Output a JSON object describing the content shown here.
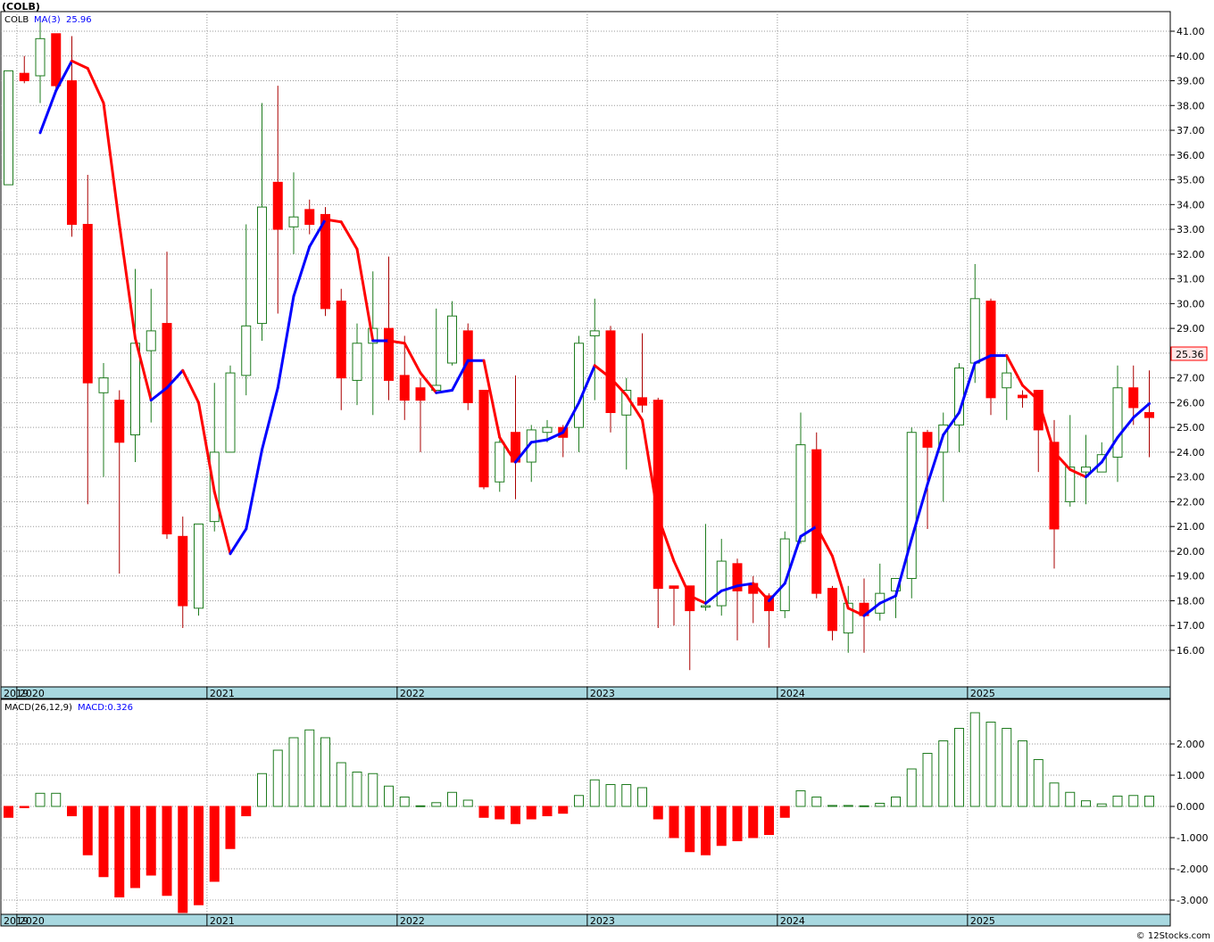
{
  "header": {
    "symbol_label": "(COLB)",
    "ma_symbol": "COLB",
    "ma_label": "MA(3)",
    "ma_value": "25.96",
    "macd_label": "MACD(26,12,9)",
    "macd_value_label": "MACD:0.326",
    "last_price": "25.36",
    "watermark": "© 12Stocks.com"
  },
  "colors": {
    "up_candle": "#1e7b1e",
    "down_candle": "#ff0000",
    "ma_up": "#0000ff",
    "ma_down": "#ff0000",
    "axis_band": "#a8d8e0",
    "price_box_fill": "#ffe6e6",
    "price_box_border": "#ff0000"
  },
  "chart_data": [
    {
      "type": "candlestick",
      "interval": "monthly",
      "ylim": [
        15.0,
        42.0
      ],
      "yticks": [
        "16.00",
        "17.00",
        "18.00",
        "19.00",
        "20.00",
        "21.00",
        "22.00",
        "23.00",
        "24.00",
        "25.00",
        "26.00",
        "27.00",
        "28.00",
        "29.00",
        "30.00",
        "31.00",
        "32.00",
        "33.00",
        "34.00",
        "35.00",
        "36.00",
        "37.00",
        "38.00",
        "39.00",
        "40.00",
        "41.00"
      ],
      "x_year_labels": [
        "2019",
        "2020",
        "2021",
        "2022",
        "2023",
        "2024",
        "2025"
      ],
      "x_year_positions": [
        -1,
        1,
        13,
        25,
        37,
        49,
        61
      ],
      "candles": [
        {
          "o": 34.8,
          "h": 38.8,
          "l": 35.1,
          "c": 39.4
        },
        {
          "o": 39.3,
          "h": 40.0,
          "l": 38.9,
          "c": 39.0
        },
        {
          "o": 39.2,
          "h": 41.5,
          "l": 38.1,
          "c": 40.7
        },
        {
          "o": 40.9,
          "h": 40.9,
          "l": 38.5,
          "c": 38.8
        },
        {
          "o": 39.0,
          "h": 40.8,
          "l": 32.7,
          "c": 33.2
        },
        {
          "o": 33.2,
          "h": 35.2,
          "l": 21.9,
          "c": 26.8
        },
        {
          "o": 26.4,
          "h": 27.6,
          "l": 23.0,
          "c": 27.0
        },
        {
          "o": 26.1,
          "h": 26.5,
          "l": 19.1,
          "c": 24.4
        },
        {
          "o": 24.7,
          "h": 31.4,
          "l": 23.6,
          "c": 28.4
        },
        {
          "o": 28.1,
          "h": 30.6,
          "l": 25.2,
          "c": 28.9
        },
        {
          "o": 29.2,
          "h": 32.1,
          "l": 20.5,
          "c": 20.7
        },
        {
          "o": 20.6,
          "h": 21.4,
          "l": 16.9,
          "c": 17.8
        },
        {
          "o": 17.7,
          "h": 21.0,
          "l": 17.4,
          "c": 21.1
        },
        {
          "o": 21.2,
          "h": 26.8,
          "l": 20.8,
          "c": 24.0
        },
        {
          "o": 24.0,
          "h": 27.5,
          "l": 24.1,
          "c": 27.2
        },
        {
          "o": 27.1,
          "h": 33.2,
          "l": 26.3,
          "c": 29.1
        },
        {
          "o": 29.2,
          "h": 38.1,
          "l": 28.5,
          "c": 33.9
        },
        {
          "o": 34.9,
          "h": 38.8,
          "l": 29.6,
          "c": 33.0
        },
        {
          "o": 33.1,
          "h": 35.3,
          "l": 32.0,
          "c": 33.5
        },
        {
          "o": 33.8,
          "h": 34.2,
          "l": 32.8,
          "c": 33.2
        },
        {
          "o": 33.6,
          "h": 33.9,
          "l": 29.5,
          "c": 29.8
        },
        {
          "o": 30.1,
          "h": 30.6,
          "l": 25.7,
          "c": 27.0
        },
        {
          "o": 26.9,
          "h": 29.2,
          "l": 25.9,
          "c": 28.4
        },
        {
          "o": 28.4,
          "h": 31.3,
          "l": 25.5,
          "c": 29.0
        },
        {
          "o": 29.0,
          "h": 31.9,
          "l": 26.1,
          "c": 26.9
        },
        {
          "o": 27.1,
          "h": 28.7,
          "l": 25.3,
          "c": 26.1
        },
        {
          "o": 26.6,
          "h": 27.0,
          "l": 24.0,
          "c": 26.1
        },
        {
          "o": 26.5,
          "h": 29.8,
          "l": 26.5,
          "c": 26.7
        },
        {
          "o": 27.6,
          "h": 30.1,
          "l": 27.5,
          "c": 29.5
        },
        {
          "o": 28.9,
          "h": 29.2,
          "l": 25.7,
          "c": 26.0
        },
        {
          "o": 26.5,
          "h": 26.4,
          "l": 22.5,
          "c": 22.6
        },
        {
          "o": 22.8,
          "h": 24.5,
          "l": 22.4,
          "c": 24.4
        },
        {
          "o": 24.8,
          "h": 27.1,
          "l": 22.1,
          "c": 23.6
        },
        {
          "o": 23.6,
          "h": 25.1,
          "l": 22.8,
          "c": 24.9
        },
        {
          "o": 24.8,
          "h": 25.3,
          "l": 24.4,
          "c": 25.0
        },
        {
          "o": 25.0,
          "h": 25.1,
          "l": 23.8,
          "c": 24.6
        },
        {
          "o": 25.0,
          "h": 28.7,
          "l": 24.0,
          "c": 28.4
        },
        {
          "o": 28.7,
          "h": 30.2,
          "l": 26.1,
          "c": 28.9
        },
        {
          "o": 28.9,
          "h": 29.1,
          "l": 24.8,
          "c": 25.6
        },
        {
          "o": 25.5,
          "h": 27.0,
          "l": 23.3,
          "c": 26.5
        },
        {
          "o": 26.2,
          "h": 28.8,
          "l": 25.6,
          "c": 25.9
        },
        {
          "o": 26.1,
          "h": 26.2,
          "l": 16.9,
          "c": 18.5
        },
        {
          "o": 18.6,
          "h": 18.6,
          "l": 17.0,
          "c": 18.5
        },
        {
          "o": 18.6,
          "h": 18.6,
          "l": 15.2,
          "c": 17.6
        },
        {
          "o": 17.8,
          "h": 21.1,
          "l": 17.6,
          "c": 17.8
        },
        {
          "o": 17.8,
          "h": 20.5,
          "l": 17.4,
          "c": 19.6
        },
        {
          "o": 19.5,
          "h": 19.7,
          "l": 16.4,
          "c": 18.4
        },
        {
          "o": 18.7,
          "h": 19.0,
          "l": 17.1,
          "c": 18.3
        },
        {
          "o": 18.2,
          "h": 18.3,
          "l": 16.1,
          "c": 17.6
        },
        {
          "o": 17.6,
          "h": 20.8,
          "l": 17.3,
          "c": 20.5
        },
        {
          "o": 20.4,
          "h": 25.6,
          "l": 20.3,
          "c": 24.3
        },
        {
          "o": 24.1,
          "h": 24.8,
          "l": 18.1,
          "c": 18.3
        },
        {
          "o": 18.5,
          "h": 18.6,
          "l": 16.4,
          "c": 16.8
        },
        {
          "o": 16.7,
          "h": 18.6,
          "l": 15.9,
          "c": 17.9
        },
        {
          "o": 17.9,
          "h": 18.9,
          "l": 15.9,
          "c": 17.4
        },
        {
          "o": 17.5,
          "h": 19.5,
          "l": 17.2,
          "c": 18.3
        },
        {
          "o": 18.4,
          "h": 18.9,
          "l": 17.3,
          "c": 18.9
        },
        {
          "o": 18.9,
          "h": 25.0,
          "l": 18.1,
          "c": 24.8
        },
        {
          "o": 24.8,
          "h": 24.9,
          "l": 20.9,
          "c": 24.2
        },
        {
          "o": 24.0,
          "h": 25.6,
          "l": 22.0,
          "c": 25.1
        },
        {
          "o": 25.1,
          "h": 27.6,
          "l": 24.0,
          "c": 27.4
        },
        {
          "o": 27.6,
          "h": 31.6,
          "l": 26.8,
          "c": 30.2
        },
        {
          "o": 30.1,
          "h": 30.2,
          "l": 25.5,
          "c": 26.2
        },
        {
          "o": 26.6,
          "h": 27.9,
          "l": 25.3,
          "c": 27.2
        },
        {
          "o": 26.3,
          "h": 26.5,
          "l": 25.8,
          "c": 26.2
        },
        {
          "o": 26.5,
          "h": 26.5,
          "l": 23.2,
          "c": 24.9
        },
        {
          "o": 24.4,
          "h": 25.3,
          "l": 19.3,
          "c": 20.9
        },
        {
          "o": 22.0,
          "h": 25.5,
          "l": 21.8,
          "c": 23.4
        },
        {
          "o": 23.2,
          "h": 24.7,
          "l": 21.9,
          "c": 23.4
        },
        {
          "o": 23.2,
          "h": 24.4,
          "l": 23.2,
          "c": 23.9
        },
        {
          "o": 23.8,
          "h": 27.5,
          "l": 22.8,
          "c": 26.6
        },
        {
          "o": 26.6,
          "h": 27.5,
          "l": 25.1,
          "c": 25.8
        },
        {
          "o": 25.6,
          "h": 27.3,
          "l": 23.8,
          "c": 25.4
        }
      ],
      "ma3": [
        null,
        null,
        36.9,
        38.6,
        39.8,
        39.5,
        38.1,
        33.2,
        28.6,
        26.1,
        26.6,
        27.3,
        26.0,
        22.4,
        19.9,
        20.9,
        24.1,
        26.6,
        30.3,
        32.3,
        33.4,
        33.3,
        32.2,
        28.5,
        28.5,
        28.4,
        27.2,
        26.4,
        26.5,
        27.7,
        27.7,
        24.6,
        23.6,
        24.4,
        24.5,
        24.8,
        26.0,
        27.5,
        27.0,
        26.3,
        25.3,
        21.4,
        19.6,
        18.2,
        17.9,
        18.4,
        18.6,
        18.7,
        18.0,
        18.7,
        20.6,
        21.0,
        19.8,
        17.7,
        17.4,
        17.9,
        18.2,
        20.5,
        22.7,
        24.7,
        25.6,
        27.6,
        27.9,
        27.9,
        26.7,
        26.1,
        24.0,
        23.3,
        23.0,
        23.6,
        24.6,
        25.4,
        25.96
      ],
      "last_price": 25.36
    },
    {
      "type": "bar",
      "title": "MACD(26,12,9)",
      "ylim": [
        -3.4,
        3.1
      ],
      "yticks": [
        "-3.000",
        "-2.000",
        "-1.000",
        "0.000",
        "1.000",
        "2.000"
      ],
      "values": [
        -0.35,
        -0.04,
        0.42,
        0.42,
        -0.3,
        -1.55,
        -2.25,
        -2.9,
        -2.6,
        -2.2,
        -2.85,
        -3.4,
        -3.15,
        -2.4,
        -1.35,
        -0.3,
        1.05,
        1.8,
        2.2,
        2.45,
        2.2,
        1.4,
        1.1,
        1.05,
        0.65,
        0.3,
        0.02,
        0.12,
        0.45,
        0.2,
        -0.35,
        -0.4,
        -0.55,
        -0.4,
        -0.3,
        -0.22,
        0.35,
        0.85,
        0.7,
        0.7,
        0.6,
        -0.4,
        -1.0,
        -1.45,
        -1.55,
        -1.25,
        -1.1,
        -1.0,
        -0.9,
        -0.35,
        0.5,
        0.3,
        0.03,
        0.03,
        0.02,
        0.1,
        0.3,
        1.2,
        1.7,
        2.1,
        2.5,
        3.0,
        2.7,
        2.5,
        2.1,
        1.5,
        0.75,
        0.45,
        0.18,
        0.08,
        0.33,
        0.35,
        0.33
      ]
    }
  ]
}
